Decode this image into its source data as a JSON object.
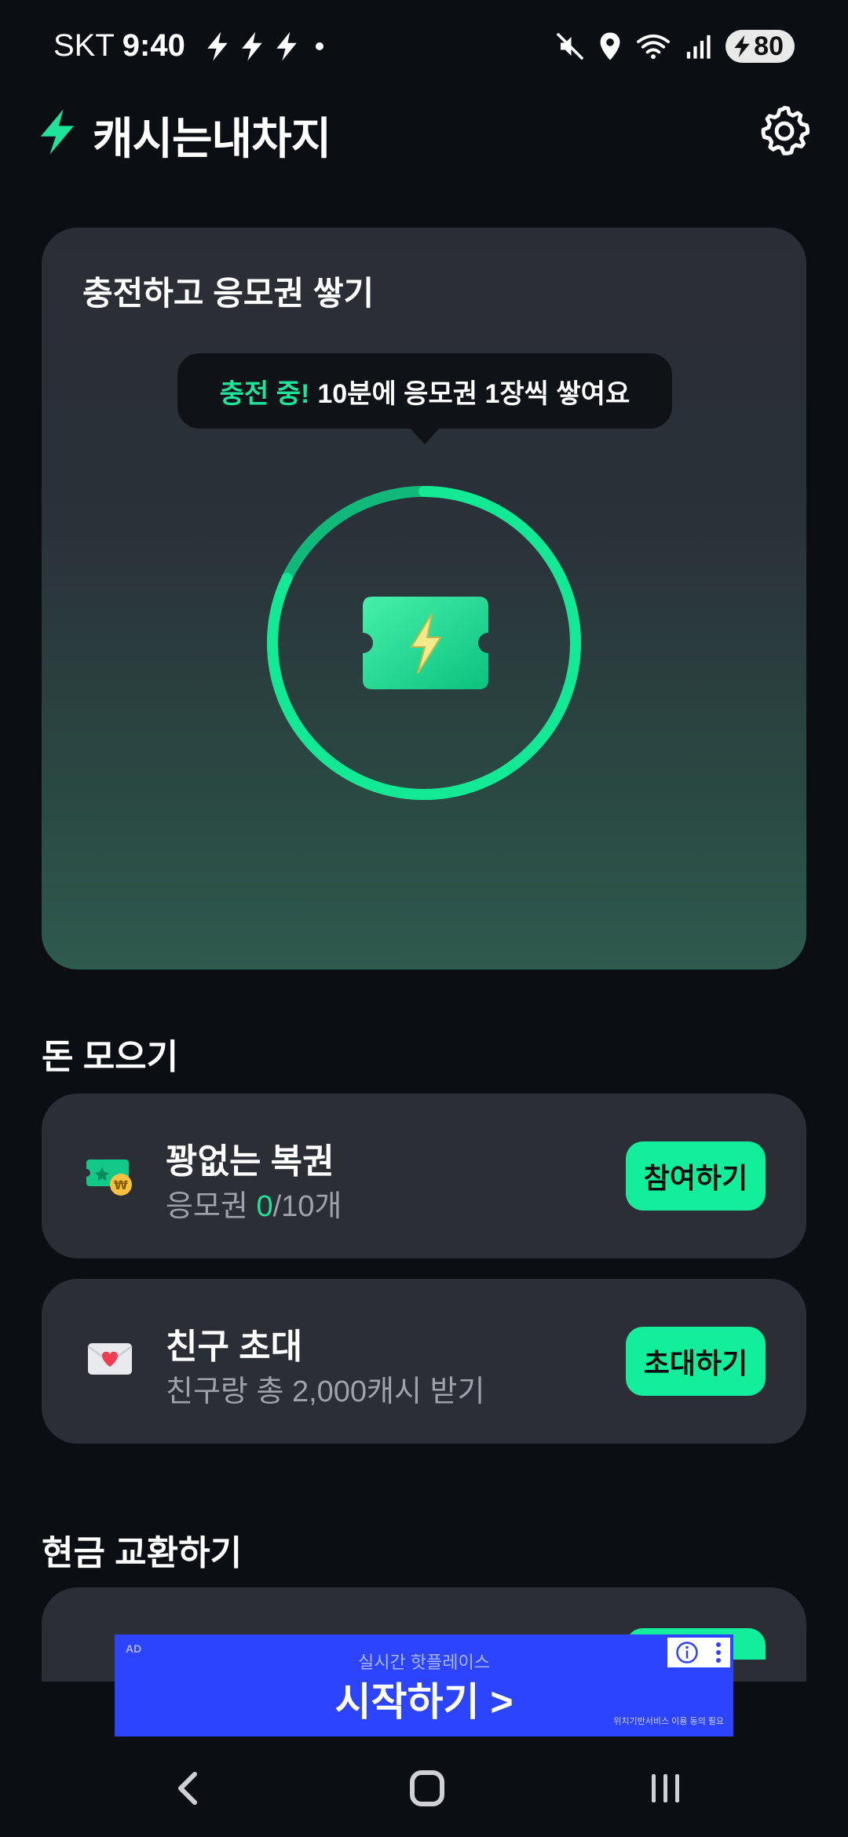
{
  "status_bar": {
    "carrier": "SKT",
    "time": "9:40",
    "battery": "80",
    "icons": [
      "bolt-icon",
      "bolt-icon",
      "bolt-icon",
      "mute-icon",
      "location-icon",
      "wifi-icon",
      "signal-icon",
      "battery-charging-icon"
    ]
  },
  "header": {
    "title": "캐시는내차지",
    "logo_icon": "bolt-logo-icon",
    "settings_icon": "gear-icon"
  },
  "charge_card": {
    "title": "충전하고 응모권 쌓기",
    "tooltip_accent": "충전 중!",
    "tooltip_text": "10분에 응모권 1장씩 쌓여요",
    "progress": 0.82,
    "ticket_icon": "lightning-ticket-icon"
  },
  "earn_section": {
    "title": "돈 모으기",
    "items": [
      {
        "title": "꽝없는 복권",
        "sub_prefix": "응모권 ",
        "sub_accent": "0",
        "sub_suffix": "/10개",
        "button": "참여하기",
        "icon": "lottery-ticket-icon"
      },
      {
        "title": "친구 초대",
        "sub": "친구랑 총 2,000캐시 받기",
        "button": "초대하기",
        "icon": "envelope-heart-icon"
      }
    ]
  },
  "exchange_section": {
    "title": "현금 교환하기"
  },
  "ad": {
    "tag": "AD",
    "sub": "실시간 핫플레이스",
    "main": "시작하기 >",
    "fine_print": "위치기반서비스 이용 동의 필요",
    "info_icon": "info-icon",
    "menu_icon": "kebab-menu-icon"
  },
  "nav": {
    "back_icon": "back-chevron-icon",
    "home_icon": "home-icon",
    "recents_icon": "recents-icon"
  },
  "colors": {
    "accent": "#13ee9b",
    "background": "#0b0e13",
    "card": "#2c2e35",
    "ad_blue": "#2d44ff"
  }
}
